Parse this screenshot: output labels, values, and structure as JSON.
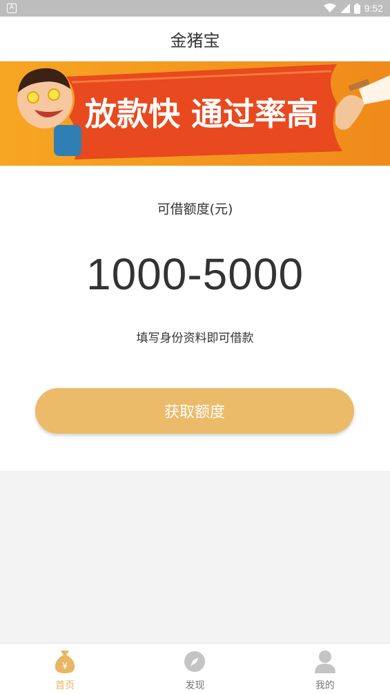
{
  "status_bar": {
    "time": "9:52",
    "icons": [
      "wifi-icon",
      "signal-icon",
      "battery-icon"
    ],
    "left_badge": "A"
  },
  "app": {
    "title": "金猪宝"
  },
  "banner": {
    "headline": "放款快 通过率高",
    "colors": {
      "background": "#f39a1d",
      "ribbon": "#e8491e"
    }
  },
  "main": {
    "limit_label": "可借额度(元)",
    "limit_value": "1000-5000",
    "hint": "填写身份资料即可借款",
    "button_label": "获取额度",
    "button_color": "#ebbb6a"
  },
  "tabs": [
    {
      "label": "首页",
      "icon": "money-bag-icon",
      "active": true
    },
    {
      "label": "发现",
      "icon": "compass-icon",
      "active": false
    },
    {
      "label": "我的",
      "icon": "person-icon",
      "active": false
    }
  ],
  "colors": {
    "accent": "#e8b563",
    "inactive": "#c4c4c4"
  }
}
